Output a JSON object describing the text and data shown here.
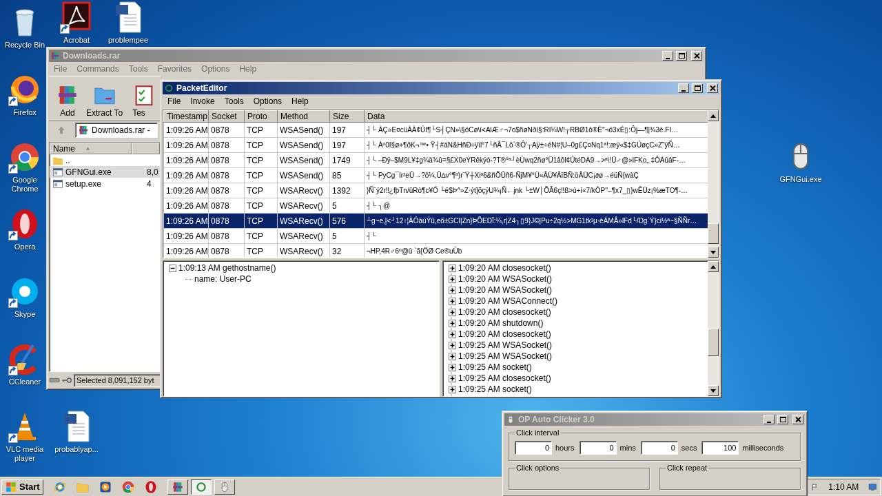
{
  "desktop_icons": [
    {
      "label": "Recycle Bin",
      "kind": "recycle",
      "shortcut": false
    },
    {
      "label": "Acrobat",
      "kind": "acrobat",
      "shortcut": true
    },
    {
      "label": "problempee",
      "kind": "word",
      "shortcut": false
    },
    {
      "label": "Firefox",
      "kind": "firefox",
      "shortcut": true
    },
    {
      "label": "Google Chrome",
      "kind": "chrome",
      "shortcut": true
    },
    {
      "label": "Opera",
      "kind": "opera",
      "shortcut": true
    },
    {
      "label": "Skype",
      "kind": "skype",
      "shortcut": true
    },
    {
      "label": "CCleaner",
      "kind": "ccleaner",
      "shortcut": true
    },
    {
      "label": "VLC media player",
      "kind": "vlc",
      "shortcut": true
    },
    {
      "label": "probablyap...",
      "kind": "word",
      "shortcut": false
    },
    {
      "label": "GFNGui.exe",
      "kind": "mouse",
      "shortcut": false
    }
  ],
  "winrar": {
    "title": "Downloads.rar",
    "active": false,
    "menu": [
      "File",
      "Commands",
      "Tools",
      "Favorites",
      "Options",
      "Help"
    ],
    "toolbar": [
      {
        "label": "Add",
        "kind": "add"
      },
      {
        "label": "Extract To",
        "kind": "extract"
      },
      {
        "label": "Tes",
        "kind": "test"
      }
    ],
    "address": "Downloads.rar -",
    "column": "Name",
    "files": [
      {
        "name": "..",
        "kind": "folder",
        "selected": false
      },
      {
        "name": "GFNGui.exe",
        "size": "8,0",
        "kind": "exe",
        "selected": true
      },
      {
        "name": "setup.exe",
        "size": "4",
        "kind": "exe",
        "selected": false
      }
    ],
    "status": "Selected 8,091,152 byt"
  },
  "packet_editor": {
    "title": "PacketEditor",
    "active": true,
    "menu": [
      "File",
      "Invoke",
      "Tools",
      "Options",
      "Help"
    ],
    "columns": [
      "Timestamp",
      "Socket",
      "Proto",
      "Method",
      "Size",
      "Data"
    ],
    "rows": [
      {
        "cells": [
          "1:09:26 AM",
          "0878",
          "TCP",
          "WSASend()",
          "197",
          "┤└    ÀÇ»E¤cüÀÀ¢ÚI¶└S┤ÇN»\\§öCø\\í<AlÆ♂¬7o$ñøNðí§:RI¼W!┬RBØ1ô®È''¬ö3xÉ▯:Ôj—¶|¾3è.FI…"
        ],
        "selected": false
      },
      {
        "cells": [
          "1:09:26 AM",
          "0878",
          "TCP",
          "WSASend()",
          "197",
          "┤└    Àº0I§ø+¶ðK¬™• Ÿ┤#áN&HñÐ÷ÿïl°7└ñÅ¯Lô´®Ô'┬Aÿ±÷éN#¦U–0g£Ç¤Nq1ª!:æÿ«$‡GÚøçC»Z˜ÿÑ…"
        ],
        "selected": false
      },
      {
        "cells": [
          "1:09:26 AM",
          "0878",
          "TCP",
          "WSASend()",
          "1749",
          "┤└    –Ðÿ–$M9L¥‡g¾ä¾û=§£X0eÝRêkýò-?T®°ª┘èÙwq2ñø°Ü1âôl¢ÛtéDA9→>ª\\!Ü♂@»lFKo„ ‡ÔÁûâF-…"
        ],
        "selected": false
      },
      {
        "cells": [
          "1:09:26 AM",
          "0878",
          "TCP",
          "WSASend()",
          "85",
          "┤└    PyCg¯Ir²eÛ→?ô¼,Û∆v°¶ª)r¨Ÿ┼Xiª6&ñÕÛñ6-ÑjM¥°Ü«ÂÜ¥ÂïBÑ:öÂÜC¡∂ø→éüÑ{wàÇ"
        ],
        "selected": false
      },
      {
        "cells": [
          "1:09:26 AM",
          "0878",
          "TCP",
          "WSARecv()",
          "1392",
          "}Ñ¨ý2r‼¿fþTn/üRò¶c¥Ó └ë$Þ^»Z·ýt]õçÿU¾¡Ñ←jnk └±W│ÕÂ6ç‼ß>ú÷í«7/kÒP''–¶x7_▯}wÊÜz¡%æTO¶-…"
        ],
        "selected": false
      },
      {
        "cells": [
          "1:09:26 AM",
          "0878",
          "TCP",
          "WSARecv()",
          "5",
          "┤└   ┐@"
        ],
        "selected": false
      },
      {
        "cells": [
          "1:09:26 AM",
          "0878",
          "TCP",
          "WSARecv()",
          "576",
          "┴g~e,|<┘12↑¦ÀÓàùÝû,eõ±GCI|Zn}ÞÕEDÏ:¼,r|Z4┐▯9}J©|Pu÷2q½>MG1tk³µ·èÁMÅ»lFd└/Dg´Ý}ci½ª~§ÑÑr…"
        ],
        "selected": true
      },
      {
        "cells": [
          "1:09:26 AM",
          "0878",
          "TCP",
          "WSARecv()",
          "5",
          "┤└"
        ],
        "selected": false
      },
      {
        "cells": [
          "1:09:26 AM",
          "0878",
          "TCP",
          "WSARecv()",
          "32",
          "¬HP,4R♂6º@û `ã{ÖØ  Ce®uÙb"
        ],
        "selected": false
      }
    ],
    "left_tree": [
      {
        "label": "1:09:13 AM gethostname()",
        "expanded": true,
        "children": [
          {
            "label": "name: User-PC"
          }
        ]
      }
    ],
    "right_tree": [
      {
        "label": "1:09:20 AM closesocket()",
        "expanded": false
      },
      {
        "label": "1:09:20 AM WSASocket()",
        "expanded": false
      },
      {
        "label": "1:09:20 AM WSASocket()",
        "expanded": false
      },
      {
        "label": "1:09:20 AM WSAConnect()",
        "expanded": false
      },
      {
        "label": "1:09:20 AM closesocket()",
        "expanded": false
      },
      {
        "label": "1:09:20 AM shutdown()",
        "expanded": false
      },
      {
        "label": "1:09:20 AM closesocket()",
        "expanded": false
      },
      {
        "label": "1:09:25 AM WSASocket()",
        "expanded": false
      },
      {
        "label": "1:09:25 AM WSASocket()",
        "expanded": false
      },
      {
        "label": "1:09:25 AM socket()",
        "expanded": false
      },
      {
        "label": "1:09:25 AM closesocket()",
        "expanded": false
      },
      {
        "label": "1:09:25 AM socket()",
        "expanded": false
      }
    ]
  },
  "auto_clicker": {
    "title": "OP Auto Clicker 3.0",
    "active": false,
    "interval_group": "Click interval",
    "interval": [
      {
        "value": "0",
        "unit": "hours"
      },
      {
        "value": "0",
        "unit": "mins"
      },
      {
        "value": "0",
        "unit": "secs"
      },
      {
        "value": "100",
        "unit": "milliseconds"
      }
    ],
    "groups": [
      "Click options",
      "Click repeat"
    ]
  },
  "taskbar": {
    "start": "Start",
    "quick_launch": [
      {
        "kind": "ie"
      },
      {
        "kind": "explorer"
      },
      {
        "kind": "media"
      },
      {
        "kind": "chrome"
      },
      {
        "kind": "opera"
      }
    ],
    "tasks": [
      {
        "kind": "winrar",
        "selected": false
      },
      {
        "kind": "packet",
        "selected": true
      },
      {
        "kind": "mouse",
        "selected": false
      }
    ],
    "clock": "1:10 AM"
  }
}
